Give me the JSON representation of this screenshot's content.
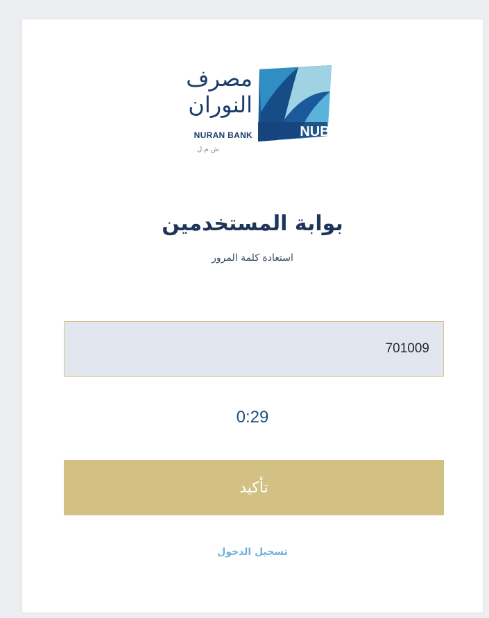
{
  "logo": {
    "arabic_line1": "مصرف",
    "arabic_line2": "النوران",
    "english_name": "NURAN BANK",
    "subtext": "ش.م.ل",
    "mark_text": "NUB"
  },
  "header": {
    "title": "بوابة المستخدمين",
    "subtitle": "استعادة كلمة المرور"
  },
  "otp": {
    "value": "701009"
  },
  "timer": {
    "text": "0:29"
  },
  "actions": {
    "confirm_label": "تأكيد",
    "login_link": "تسجيل الدخول"
  },
  "colors": {
    "brand_navy": "#1b3c6b",
    "accent_gold": "#d3c184",
    "link_blue": "#6fb3d6"
  }
}
